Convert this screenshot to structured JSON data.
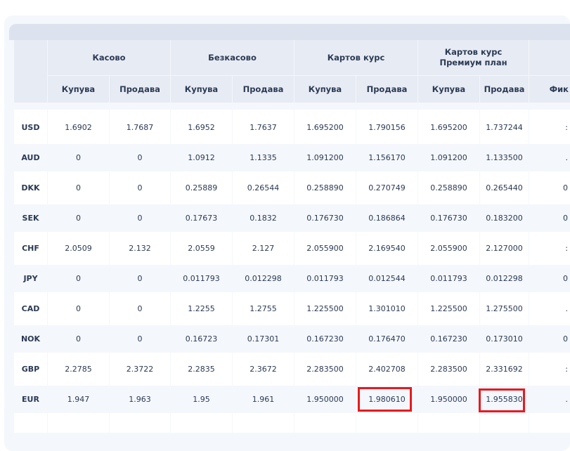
{
  "table": {
    "groups": [
      {
        "label": "Касово"
      },
      {
        "label": "Безкасово"
      },
      {
        "label": "Картов курс"
      },
      {
        "label": "Картов курс\nПремиум план"
      }
    ],
    "subheaders": [
      "Купува",
      "Продава",
      "Купува",
      "Продава",
      "Купува",
      "Продава",
      "Купува",
      "Продава"
    ],
    "cutoff_header": "Фик",
    "rows": [
      {
        "code": "USD",
        "values": [
          "1.6902",
          "1.7687",
          "1.6952",
          "1.7637",
          "1.695200",
          "1.790156",
          "1.695200",
          "1.737244"
        ],
        "cutoff": ":"
      },
      {
        "code": "AUD",
        "values": [
          "0",
          "0",
          "1.0912",
          "1.1335",
          "1.091200",
          "1.156170",
          "1.091200",
          "1.133500"
        ],
        "cutoff": "."
      },
      {
        "code": "DKK",
        "values": [
          "0",
          "0",
          "0.25889",
          "0.26544",
          "0.258890",
          "0.270749",
          "0.258890",
          "0.265440"
        ],
        "cutoff": "0"
      },
      {
        "code": "SEK",
        "values": [
          "0",
          "0",
          "0.17673",
          "0.1832",
          "0.176730",
          "0.186864",
          "0.176730",
          "0.183200"
        ],
        "cutoff": "0"
      },
      {
        "code": "CHF",
        "values": [
          "2.0509",
          "2.132",
          "2.0559",
          "2.127",
          "2.055900",
          "2.169540",
          "2.055900",
          "2.127000"
        ],
        "cutoff": ":"
      },
      {
        "code": "JPY",
        "values": [
          "0",
          "0",
          "0.011793",
          "0.012298",
          "0.011793",
          "0.012544",
          "0.011793",
          "0.012298"
        ],
        "cutoff": "0"
      },
      {
        "code": "CAD",
        "values": [
          "0",
          "0",
          "1.2255",
          "1.2755",
          "1.225500",
          "1.301010",
          "1.225500",
          "1.275500"
        ],
        "cutoff": "."
      },
      {
        "code": "NOK",
        "values": [
          "0",
          "0",
          "0.16723",
          "0.17301",
          "0.167230",
          "0.176470",
          "0.167230",
          "0.173010"
        ],
        "cutoff": "0"
      },
      {
        "code": "GBP",
        "values": [
          "2.2785",
          "2.3722",
          "2.2835",
          "2.3672",
          "2.283500",
          "2.402708",
          "2.283500",
          "2.331692"
        ],
        "cutoff": ":"
      },
      {
        "code": "EUR",
        "values": [
          "1.947",
          "1.963",
          "1.95",
          "1.961",
          "1.950000",
          "1.980610",
          "1.950000",
          "1.955830"
        ],
        "cutoff": "."
      }
    ]
  },
  "highlight_color": "#e8191f"
}
